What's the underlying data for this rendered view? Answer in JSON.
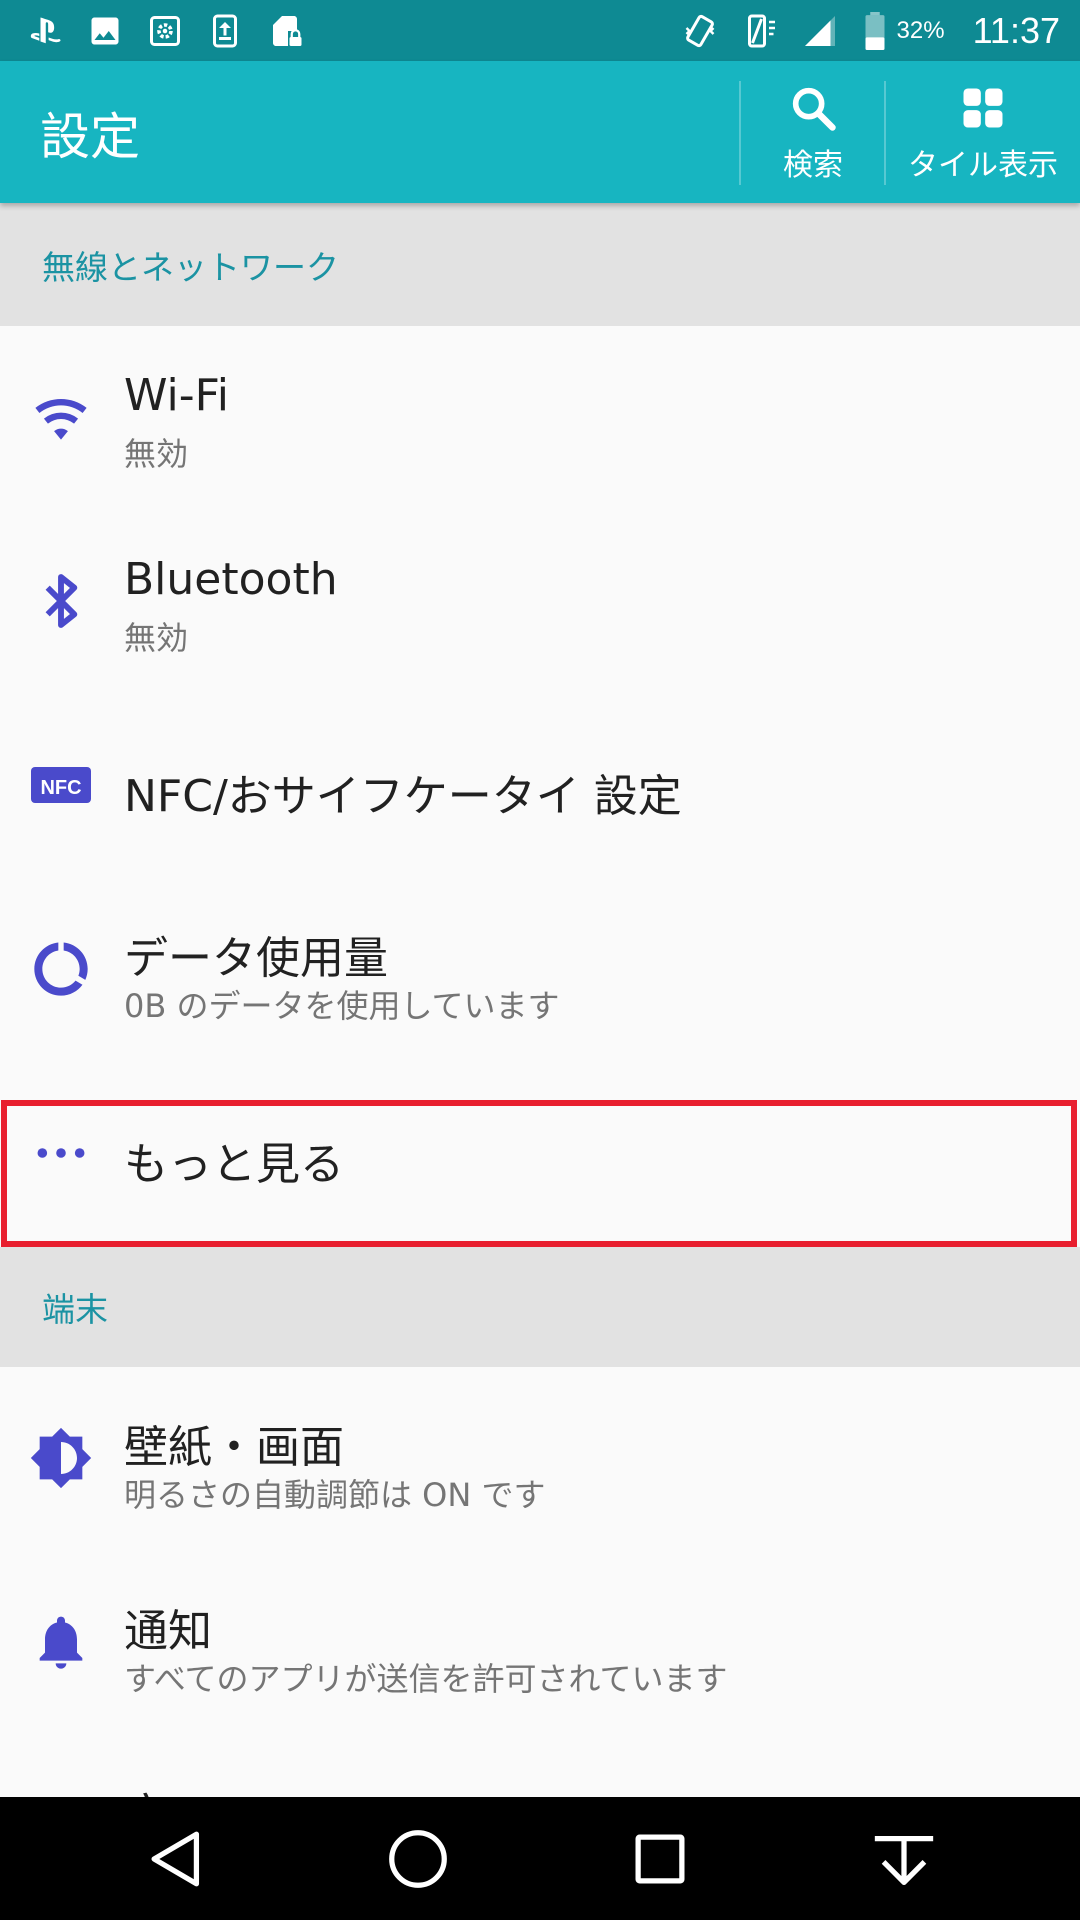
{
  "status_bar": {
    "left_icons": [
      "playstation-icon",
      "image-icon",
      "settings-box-icon",
      "upload-icon",
      "sd-card-lock-icon"
    ],
    "right_icons": [
      "vibrate-icon",
      "phone-signal-icon",
      "cell-signal-icon",
      "battery-icon"
    ],
    "battery": "32%",
    "time": "11:37"
  },
  "app_bar": {
    "title": "設定",
    "actions": [
      {
        "icon": "search-icon",
        "label": "検索"
      },
      {
        "icon": "grid-icon",
        "label": "タイル表示"
      }
    ]
  },
  "sections": [
    {
      "header": "無線とネットワーク",
      "items": [
        {
          "icon": "wifi-icon",
          "title": "Wi-Fi",
          "subtitle": "無効"
        },
        {
          "icon": "bluetooth-icon",
          "title": "Bluetooth",
          "subtitle": "無効"
        },
        {
          "icon": "nfc-icon",
          "icon_text": "NFC",
          "title": "NFC/おサイフケータイ 設定"
        },
        {
          "icon": "data-usage-icon",
          "title": "データ使用量",
          "subtitle": "0B のデータを使用しています"
        },
        {
          "icon": "more-icon",
          "title": "もっと見る"
        }
      ]
    },
    {
      "header": "端末",
      "items": [
        {
          "icon": "brightness-icon",
          "title": "壁紙・画面",
          "subtitle": "明るさの自動調節は ON です"
        },
        {
          "icon": "bell-icon",
          "title": "通知",
          "subtitle": "すべてのアプリが送信を許可されています"
        },
        {
          "icon": "",
          "title": "音"
        }
      ]
    }
  ],
  "nav_bar": {
    "buttons": [
      "back-icon",
      "home-icon",
      "recents-icon",
      "notification-pull-icon"
    ]
  },
  "colors": {
    "status_bar": "#0e8a93",
    "app_bar": "#17b5c1",
    "section_header_text": "#1b93a3",
    "icon_tint": "#4a4acb",
    "highlight": "#e81f2f"
  }
}
